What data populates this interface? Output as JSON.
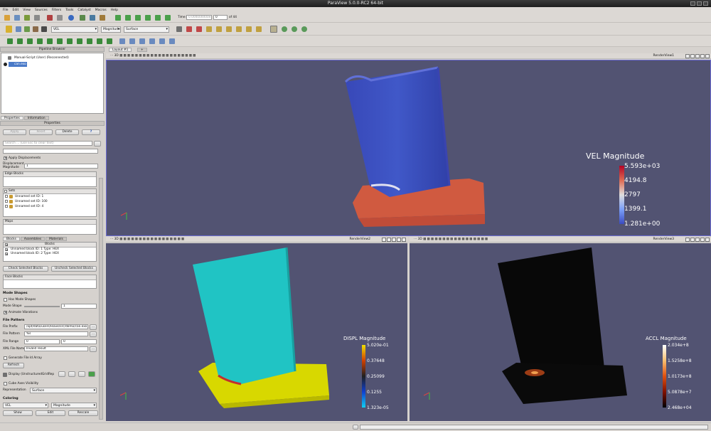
{
  "app": {
    "title": "ParaView 5.0.0-RC2 64-bit"
  },
  "menu": [
    "File",
    "Edit",
    "View",
    "Sources",
    "Filters",
    "Tools",
    "Catalyst",
    "Macros",
    "Help"
  ],
  "time": {
    "label": "Time:",
    "value": "0.000000000e+00",
    "index": "0",
    "of": "of 44"
  },
  "toolbar2": {
    "array": "VEL",
    "component": "Magnitude",
    "representation": "Surface"
  },
  "pipeline": {
    "header": "Pipeline Browser",
    "items": [
      "Manual-Script (User) (Reconnected)",
      "can.exo"
    ]
  },
  "props": {
    "tabs": [
      "Properties",
      "Information"
    ],
    "header": "Properties",
    "apply": "Apply",
    "reset": "Reset",
    "delete": "Delete",
    "help": "?",
    "search_placeholder": "Search ... (use Esc to clear text)",
    "apply_displacements": "Apply Displacements",
    "displacement_magnitude_label": "Displacement Magnitude",
    "displacement_magnitude": "1",
    "edge_blocks": "Edge Blocks",
    "sets_header": "Sets",
    "sets": [
      "Unnamed set ID: 1",
      "Unnamed set ID: 100",
      "Unnamed set ID: 4"
    ],
    "maps": "Maps",
    "block_tabs": [
      "Blocks",
      "Assemblies",
      "Materials"
    ],
    "blocks_header": "Blocks",
    "blocks": [
      "Unnamed block ID: 1 Type: HEX",
      "Unnamed block ID: 2 Type: HEX"
    ],
    "check_selected": "Check Selected Blocks",
    "uncheck_selected": "Uncheck Selected Blocks",
    "face_blocks": "Face Blocks",
    "mode_shapes": "Mode Shapes",
    "has_mode_shapes": "Has Mode Shapes",
    "mode_shape_label": "Mode Shape",
    "mode_shape_value": "1",
    "animate_vibrations": "Animate Vibrations",
    "file_pattern": "File Pattern",
    "file_prefix_label": "File Prefix",
    "file_prefix": "/opt/data/users/leave/src/demo/can.exo",
    "file_pattern_label": "File Pattern",
    "file_pattern_value": "%s",
    "file_range_label": "File Range",
    "file_range": [
      "0",
      "0"
    ],
    "xml_file_name_label": "XML File Name",
    "xml_file_name": "Invalid result",
    "generate_file_id": "Generate File Id Array",
    "refresh": "Refresh",
    "display_label": "Display (UnstructuredGridRep",
    "cube_axes": "Cube Axes Visibility",
    "representation_label": "Representation",
    "representation": "Surface",
    "coloring": "Coloring",
    "coloring_array": "VEL",
    "coloring_component": "Magnitude",
    "show": "Show",
    "edit": "Edit",
    "rescale": "Rescale"
  },
  "layout_tab": "Layout #1",
  "views": {
    "top": {
      "name": "RenderView1",
      "bar_title": "VEL Magnitude",
      "labels": [
        "5.593e+03",
        "4194.8",
        "2797",
        "1399.1",
        "1.281e+00"
      ]
    },
    "bl": {
      "name": "RenderView2",
      "bar_title": "DISPL Magnitude",
      "labels": [
        "5.020e-01",
        "0.37648",
        "0.25099",
        "0.1255",
        "1.323e-05"
      ]
    },
    "br": {
      "name": "RenderView3",
      "bar_title": "ACCL Magnitude",
      "labels": [
        "2.034e+8",
        "1.5258e+8",
        "1.0173e+8",
        "5.0878e+7",
        "2.468e+04"
      ]
    }
  },
  "colors": {
    "view_bg": "#525372",
    "accent": "#6a6ad0"
  }
}
